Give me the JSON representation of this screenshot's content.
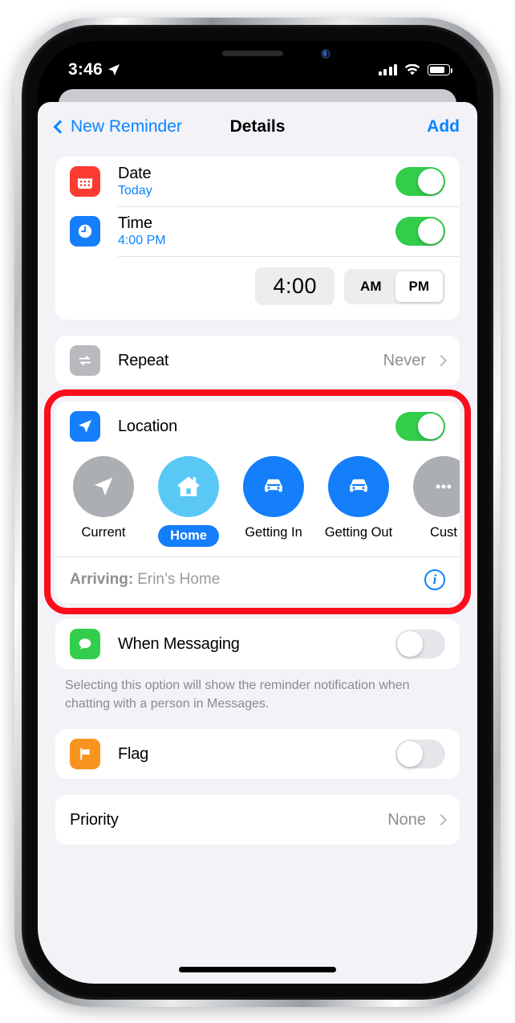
{
  "statusbar": {
    "time": "3:46",
    "location_icon": "location-arrow-icon",
    "signal_icon": "cellular-signal-icon",
    "wifi_icon": "wifi-icon",
    "battery_icon": "battery-icon"
  },
  "navbar": {
    "back_label": "New Reminder",
    "title": "Details",
    "add_label": "Add"
  },
  "date_row": {
    "title": "Date",
    "subtitle": "Today",
    "icon": "calendar-icon",
    "icon_color": "#fb3b30",
    "toggle": "on"
  },
  "time_row": {
    "title": "Time",
    "subtitle": "4:00 PM",
    "icon": "clock-icon",
    "icon_color": "#147efb",
    "toggle": "on"
  },
  "time_picker": {
    "value": "4:00",
    "am_label": "AM",
    "pm_label": "PM",
    "selected": "PM"
  },
  "repeat_row": {
    "title": "Repeat",
    "value": "Never",
    "icon": "repeat-icon",
    "icon_color": "#b8b8bd"
  },
  "location_row": {
    "title": "Location",
    "icon": "location-arrow-icon",
    "icon_color": "#147efb",
    "toggle": "on",
    "options": [
      {
        "label": "Current",
        "icon": "location-arrow-icon",
        "circle_color": "#abafb3",
        "selected": false
      },
      {
        "label": "Home",
        "icon": "house-icon",
        "circle_color": "#5ac8f5",
        "selected": true
      },
      {
        "label": "Getting In",
        "icon": "car-icon",
        "circle_color": "#147efb",
        "selected": false
      },
      {
        "label": "Getting Out",
        "icon": "car-icon",
        "circle_color": "#147efb",
        "selected": false
      },
      {
        "label": "Cust",
        "icon": "ellipsis-icon",
        "circle_color": "#abafb3",
        "selected": false
      }
    ],
    "arriving_label": "Arriving:",
    "arriving_value": "Erin’s Home",
    "info_icon": "info-circle-icon",
    "highlight_color": "#fc0d1b"
  },
  "messaging_row": {
    "title": "When Messaging",
    "icon": "message-bubble-icon",
    "icon_color": "#32cd4b",
    "toggle": "off",
    "footnote": "Selecting this option will show the reminder notification when chatting with a person in Messages."
  },
  "flag_row": {
    "title": "Flag",
    "icon": "flag-icon",
    "icon_color": "#f7941e",
    "toggle": "off"
  },
  "priority_row": {
    "title": "Priority",
    "value": "None"
  }
}
